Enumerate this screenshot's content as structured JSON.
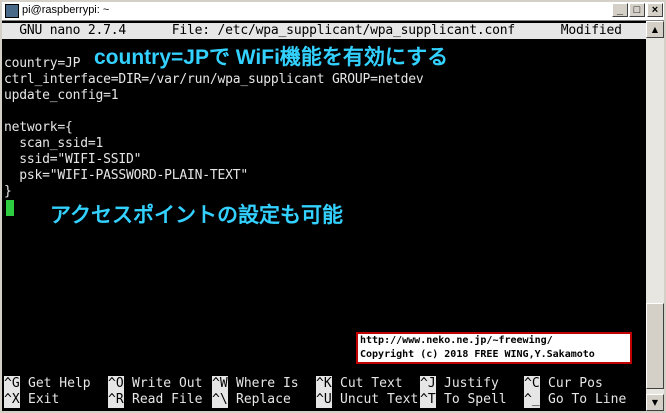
{
  "window": {
    "title": "pi@raspberrypi: ~",
    "buttons": {
      "minimize": "_",
      "maximize": "□",
      "close": "×"
    }
  },
  "nano": {
    "header": "  GNU nano 2.7.4      File: /etc/wpa_supplicant/wpa_supplicant.conf      Modified"
  },
  "file_lines": [
    "country=JP",
    "ctrl_interface=DIR=/var/run/wpa_supplicant GROUP=netdev",
    "update_config=1",
    "",
    "network={",
    "  scan_ssid=1",
    "  ssid=\"WIFI-SSID\"",
    "  psk=\"WIFI-PASSWORD-PLAIN-TEXT\"",
    "}"
  ],
  "annotations": {
    "top": "country=JPで WiFi機能を有効にする",
    "middle": "アクセスポイントの設定も可能"
  },
  "credit": {
    "url": "http://www.neko.ne.jp/~freewing/",
    "copyright": "Copyright (c) 2018 FREE WING,Y.Sakamoto"
  },
  "shortcuts": [
    {
      "key": "^G",
      "label": "Get Help"
    },
    {
      "key": "^O",
      "label": "Write Out"
    },
    {
      "key": "^W",
      "label": "Where Is"
    },
    {
      "key": "^K",
      "label": "Cut Text"
    },
    {
      "key": "^J",
      "label": "Justify"
    },
    {
      "key": "^C",
      "label": "Cur Pos"
    },
    {
      "key": "^X",
      "label": "Exit"
    },
    {
      "key": "^R",
      "label": "Read File"
    },
    {
      "key": "^\\",
      "label": "Replace"
    },
    {
      "key": "^U",
      "label": "Uncut Text"
    },
    {
      "key": "^T",
      "label": "To Spell"
    },
    {
      "key": "^_",
      "label": "Go To Line"
    }
  ],
  "scrollbar": {
    "up": "▲",
    "down": "▼"
  },
  "colors": {
    "annotation": "#33d1ff",
    "cursor": "#2ecc40",
    "credit_border": "#c00000"
  }
}
